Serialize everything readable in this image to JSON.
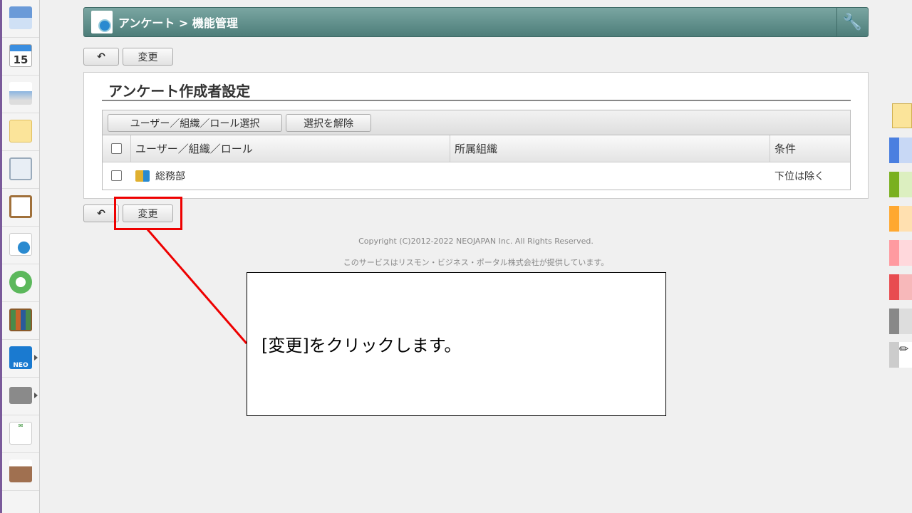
{
  "header": {
    "title": "アンケート > 機能管理"
  },
  "toolbar": {
    "change_label": "変更"
  },
  "panel": {
    "heading": "アンケート作成者設定",
    "select_button": "ユーザー／組織／ロール選択",
    "clear_button": "選択を解除",
    "columns": [
      "ユーザー／組織／ロール",
      "所属組織",
      "条件"
    ],
    "rows": [
      {
        "name": "総務部",
        "org": "",
        "condition": "下位は除く"
      }
    ]
  },
  "footer": {
    "copyright": "Copyright (C)2012-2022 NEOJAPAN Inc. All Rights Reserved.",
    "provider": "このサービスはリスモン・ビジネス・ポータル株式会社が提供しています。"
  },
  "callout": {
    "text": "[変更]をクリックします。"
  },
  "sidebar": {
    "items": [
      "portal-icon",
      "calendar-icon",
      "facility-icon",
      "memo-icon",
      "bulletin-icon",
      "clipboard-icon",
      "survey-icon",
      "workflow-icon",
      "cabinet-icon",
      "neo-icon",
      "folder-icon",
      "tanomail-icon",
      "banner-icon"
    ],
    "calendar_day": "15"
  },
  "colors": {
    "titlebar": "#5f8f8b",
    "callout_border": "#ee0000"
  },
  "right_colors": [
    [
      "#4a7fe0",
      "#c8d8f5"
    ],
    [
      "#7ab020",
      "#dcefc0"
    ],
    [
      "#ffa830",
      "#ffe0b0"
    ],
    [
      "#ff9aa0",
      "#ffd8dc"
    ],
    [
      "#e84c50",
      "#f7b8ba"
    ],
    [
      "#888888",
      "#dddddd"
    ]
  ]
}
